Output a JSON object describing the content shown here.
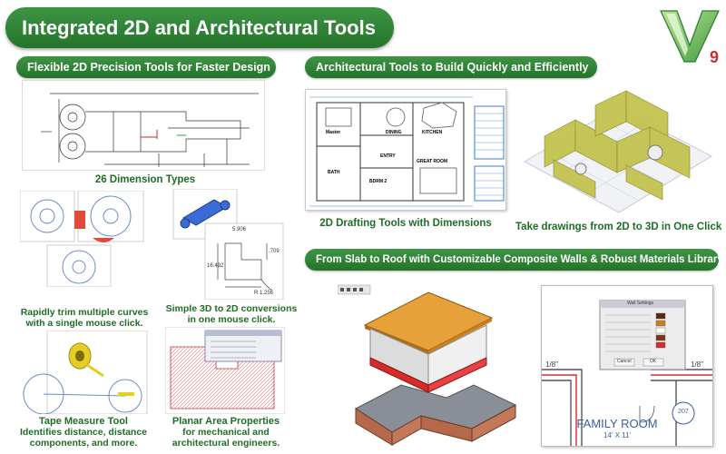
{
  "header": {
    "title": "Integrated 2D and Architectural Tools"
  },
  "logo": {
    "mark": "V",
    "version": "9"
  },
  "sections": {
    "precision": "Flexible 2D Precision Tools for Faster Design",
    "architectural": "Architectural Tools to Build Quickly and Efficiently",
    "slab": "From Slab to Roof with Customizable Composite Walls & Robust Materials Library"
  },
  "captions": {
    "dimension_types": "26 Dimension Types",
    "trim_line1": "Rapidly trim multiple curves",
    "trim_line2": "with a single mouse click.",
    "convert_line1": "Simple 3D to 2D conversions",
    "convert_line2": "in one mouse click.",
    "tape_line1": "Tape Measure Tool",
    "tape_line2": "Identifies distance, distance",
    "tape_line3": "components, and more.",
    "planar_line1": "Planar Area Properties",
    "planar_line2": "for mechanical and",
    "planar_line3": "architectural engineers.",
    "drafting": "2D Drafting Tools with Dimensions",
    "two_to_three": "Take drawings from 2D to 3D in One Click"
  },
  "plan_labels": {
    "master": "Master",
    "dining": "DINING",
    "kitchen": "KITCHEN",
    "entry": "ENTRY",
    "bath": "BATH",
    "bdrm": "BDRM 2",
    "great_room": "GREAT ROOM"
  },
  "dims": {
    "a": "5.906",
    "b": "16.492",
    "c": ".709",
    "d": "R 1.256"
  },
  "family_room": {
    "name": "FAMILY ROOM",
    "size": "14' X 11'",
    "tag": "207",
    "dim": "1/8\""
  },
  "wall_dialog": {
    "title": "Wall Settings",
    "ok": "OK",
    "cancel": "Cancel"
  },
  "colors": {
    "accent_green": "#2f8637",
    "caption_green": "#1f6d27",
    "roof_orange": "#e7a13a",
    "wall_red": "#d72b2b"
  }
}
